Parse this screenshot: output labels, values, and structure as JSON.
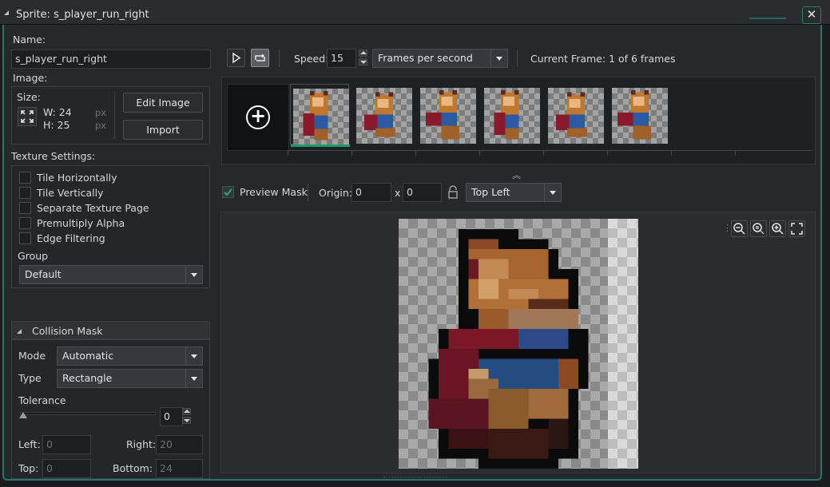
{
  "window": {
    "title": "Sprite: s_player_run_right",
    "close_glyph": "✕"
  },
  "left": {
    "name_label": "Name:",
    "name_value": "s_player_run_right",
    "image_label": "Image:",
    "size_label": "Size:",
    "width_text": "W: 24",
    "height_text": "H: 25",
    "px_unit": "px",
    "edit_image_button": "Edit Image",
    "import_button": "Import",
    "texture_settings_label": "Texture Settings:",
    "texture_options": [
      {
        "label": "Tile Horizontally",
        "checked": false
      },
      {
        "label": "Tile Vertically",
        "checked": false
      },
      {
        "label": "Separate Texture Page",
        "checked": false
      },
      {
        "label": "Premultiply Alpha",
        "checked": false
      },
      {
        "label": "Edge Filtering",
        "checked": false
      }
    ],
    "group_label": "Group",
    "group_value": "Default",
    "collision_mask_title": "Collision Mask",
    "mode_label": "Mode",
    "mode_value": "Automatic",
    "type_label": "Type",
    "type_value": "Rectangle",
    "tolerance_label": "Tolerance",
    "tolerance_value": "0",
    "left_label": "Left:",
    "left_value": "0",
    "right_label": "Right:",
    "right_value": "20",
    "top_label": "Top:",
    "top_value": "0",
    "bottom_label": "Bottom:",
    "bottom_value": "24"
  },
  "toolbar": {
    "speed_label": "Speed:",
    "speed_value": "15",
    "speed_unit": "Frames per second",
    "current_frame_text": "Current Frame: 1 of 6 frames"
  },
  "frames": {
    "count": 6,
    "selected_index": 0
  },
  "preview": {
    "preview_mask_label": "Preview Mask",
    "preview_mask_checked": true,
    "origin_label": "Origin:",
    "origin_x": "0",
    "origin_sep": "x",
    "origin_y": "0",
    "origin_preset": "Top Left"
  },
  "colors": {
    "accent": "#1f7a6d",
    "selected_frame_bar": "#1f9a6a",
    "check_green": "#3aa07a"
  }
}
